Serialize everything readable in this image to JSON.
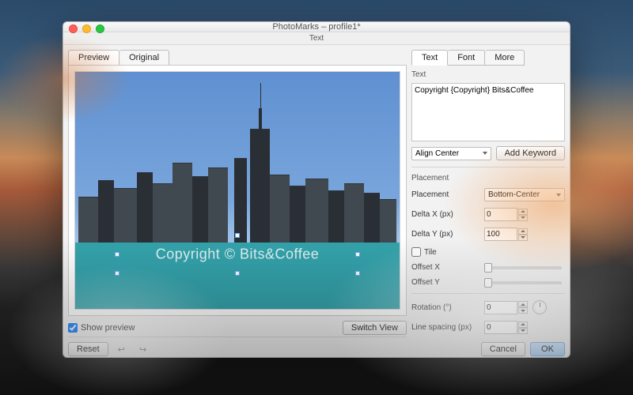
{
  "window": {
    "title": "PhotoMarks – profile1*",
    "sheet_title": "Text"
  },
  "left": {
    "tabs": [
      "Preview",
      "Original"
    ],
    "active_tab": 0,
    "watermark_rendered": "Copyright © Bits&Coffee",
    "show_preview_label": "Show preview",
    "show_preview_checked": true,
    "switch_view_label": "Switch View",
    "reset_label": "Reset"
  },
  "right": {
    "tabs": [
      "Text",
      "Font",
      "More"
    ],
    "active_tab": 0,
    "text_section_label": "Text",
    "text_value": "Copyright {Copyright} Bits&Coffee",
    "align_select": "Align Center",
    "add_keyword_label": "Add Keyword",
    "placement_section_label": "Placement",
    "placement_label": "Placement",
    "placement_value": "Bottom-Center",
    "deltax_label": "Delta X (px)",
    "deltax_value": "0",
    "deltay_label": "Delta Y (px)",
    "deltay_value": "100",
    "tile_label": "Tile",
    "tile_checked": false,
    "offsetx_label": "Offset X",
    "offsety_label": "Offset Y",
    "rotation_label": "Rotation (°)",
    "rotation_value": "0",
    "linespacing_label": "Line spacing (px)",
    "linespacing_value": "0"
  },
  "footer": {
    "cancel": "Cancel",
    "ok": "OK"
  }
}
